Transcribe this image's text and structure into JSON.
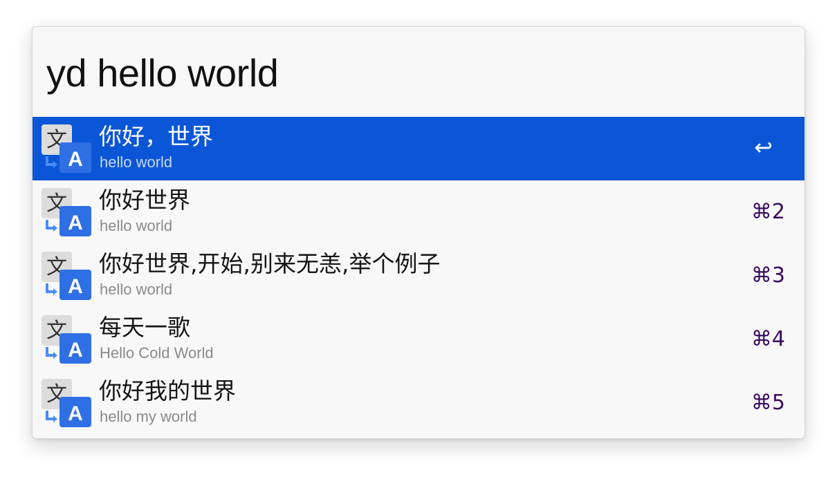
{
  "query": {
    "text": "yd hello world"
  },
  "results": [
    {
      "title": "你好，世界",
      "subtitle": "hello world",
      "shortcut": "↩",
      "icon": "translate-icon",
      "selected": true
    },
    {
      "title": "你好世界",
      "subtitle": "hello world",
      "shortcut": "⌘2",
      "icon": "translate-icon",
      "selected": false
    },
    {
      "title": "你好世界,开始,别来无恙,举个例子",
      "subtitle": "hello world",
      "shortcut": "⌘3",
      "icon": "translate-icon",
      "selected": false
    },
    {
      "title": "每天一歌",
      "subtitle": "Hello Cold World",
      "shortcut": "⌘4",
      "icon": "translate-icon",
      "selected": false
    },
    {
      "title": "你好我的世界",
      "subtitle": "hello my world",
      "shortcut": "⌘5",
      "icon": "translate-icon",
      "selected": false
    }
  ],
  "colors": {
    "selected_background": "#0b56d6",
    "shortcut_text": "#3a0a60",
    "icon_blue": "#2f6fe4"
  }
}
